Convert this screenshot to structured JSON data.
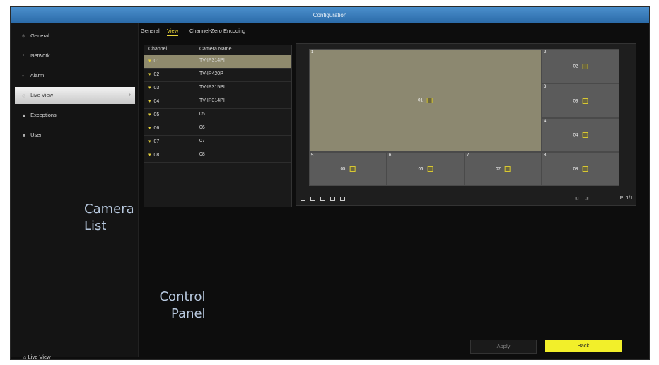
{
  "window": {
    "title": "Configuration"
  },
  "sidebar": {
    "items": [
      {
        "icon": "gear-icon",
        "label": "General"
      },
      {
        "icon": "network-icon",
        "label": "Network"
      },
      {
        "icon": "alarm-icon",
        "label": "Alarm"
      },
      {
        "icon": "eye-icon",
        "label": "Live View"
      },
      {
        "icon": "warning-icon",
        "label": "Exceptions"
      },
      {
        "icon": "user-icon",
        "label": "User"
      }
    ],
    "active_index": 3,
    "bottom": {
      "icon": "home-icon",
      "label": "Live View"
    }
  },
  "tabs": [
    "General",
    "View",
    "Channel-Zero Encoding"
  ],
  "active_tab": 1,
  "camera_list": {
    "headers": [
      "Channel",
      "Camera Name"
    ],
    "rows": [
      {
        "channel": "01",
        "name": "TV-IP314PI"
      },
      {
        "channel": "02",
        "name": "TV-IP420P"
      },
      {
        "channel": "03",
        "name": "TV-IP315PI"
      },
      {
        "channel": "04",
        "name": "TV-IP314PI"
      },
      {
        "channel": "05",
        "name": "05"
      },
      {
        "channel": "06",
        "name": "06"
      },
      {
        "channel": "07",
        "name": "07"
      },
      {
        "channel": "08",
        "name": "08"
      }
    ],
    "selected_index": 0
  },
  "preview": {
    "cells": [
      {
        "no": "1",
        "label": "01"
      },
      {
        "no": "2",
        "label": "02"
      },
      {
        "no": "3",
        "label": "03"
      },
      {
        "no": "4",
        "label": "04"
      },
      {
        "no": "5",
        "label": "05"
      },
      {
        "no": "6",
        "label": "06"
      },
      {
        "no": "7",
        "label": "07"
      },
      {
        "no": "8",
        "label": "08"
      }
    ],
    "page_indicator": "P: 1/1"
  },
  "overlay_labels": {
    "camera_list": [
      "Camera",
      "List"
    ],
    "control_panel": [
      "Control",
      "Panel"
    ]
  },
  "buttons": {
    "apply": "Apply",
    "back": "Back"
  },
  "colors": {
    "accent_yellow": "#f2ef2a",
    "titlebar_blue": "#3a7fbf",
    "selected_row": "#8f8a6d"
  }
}
